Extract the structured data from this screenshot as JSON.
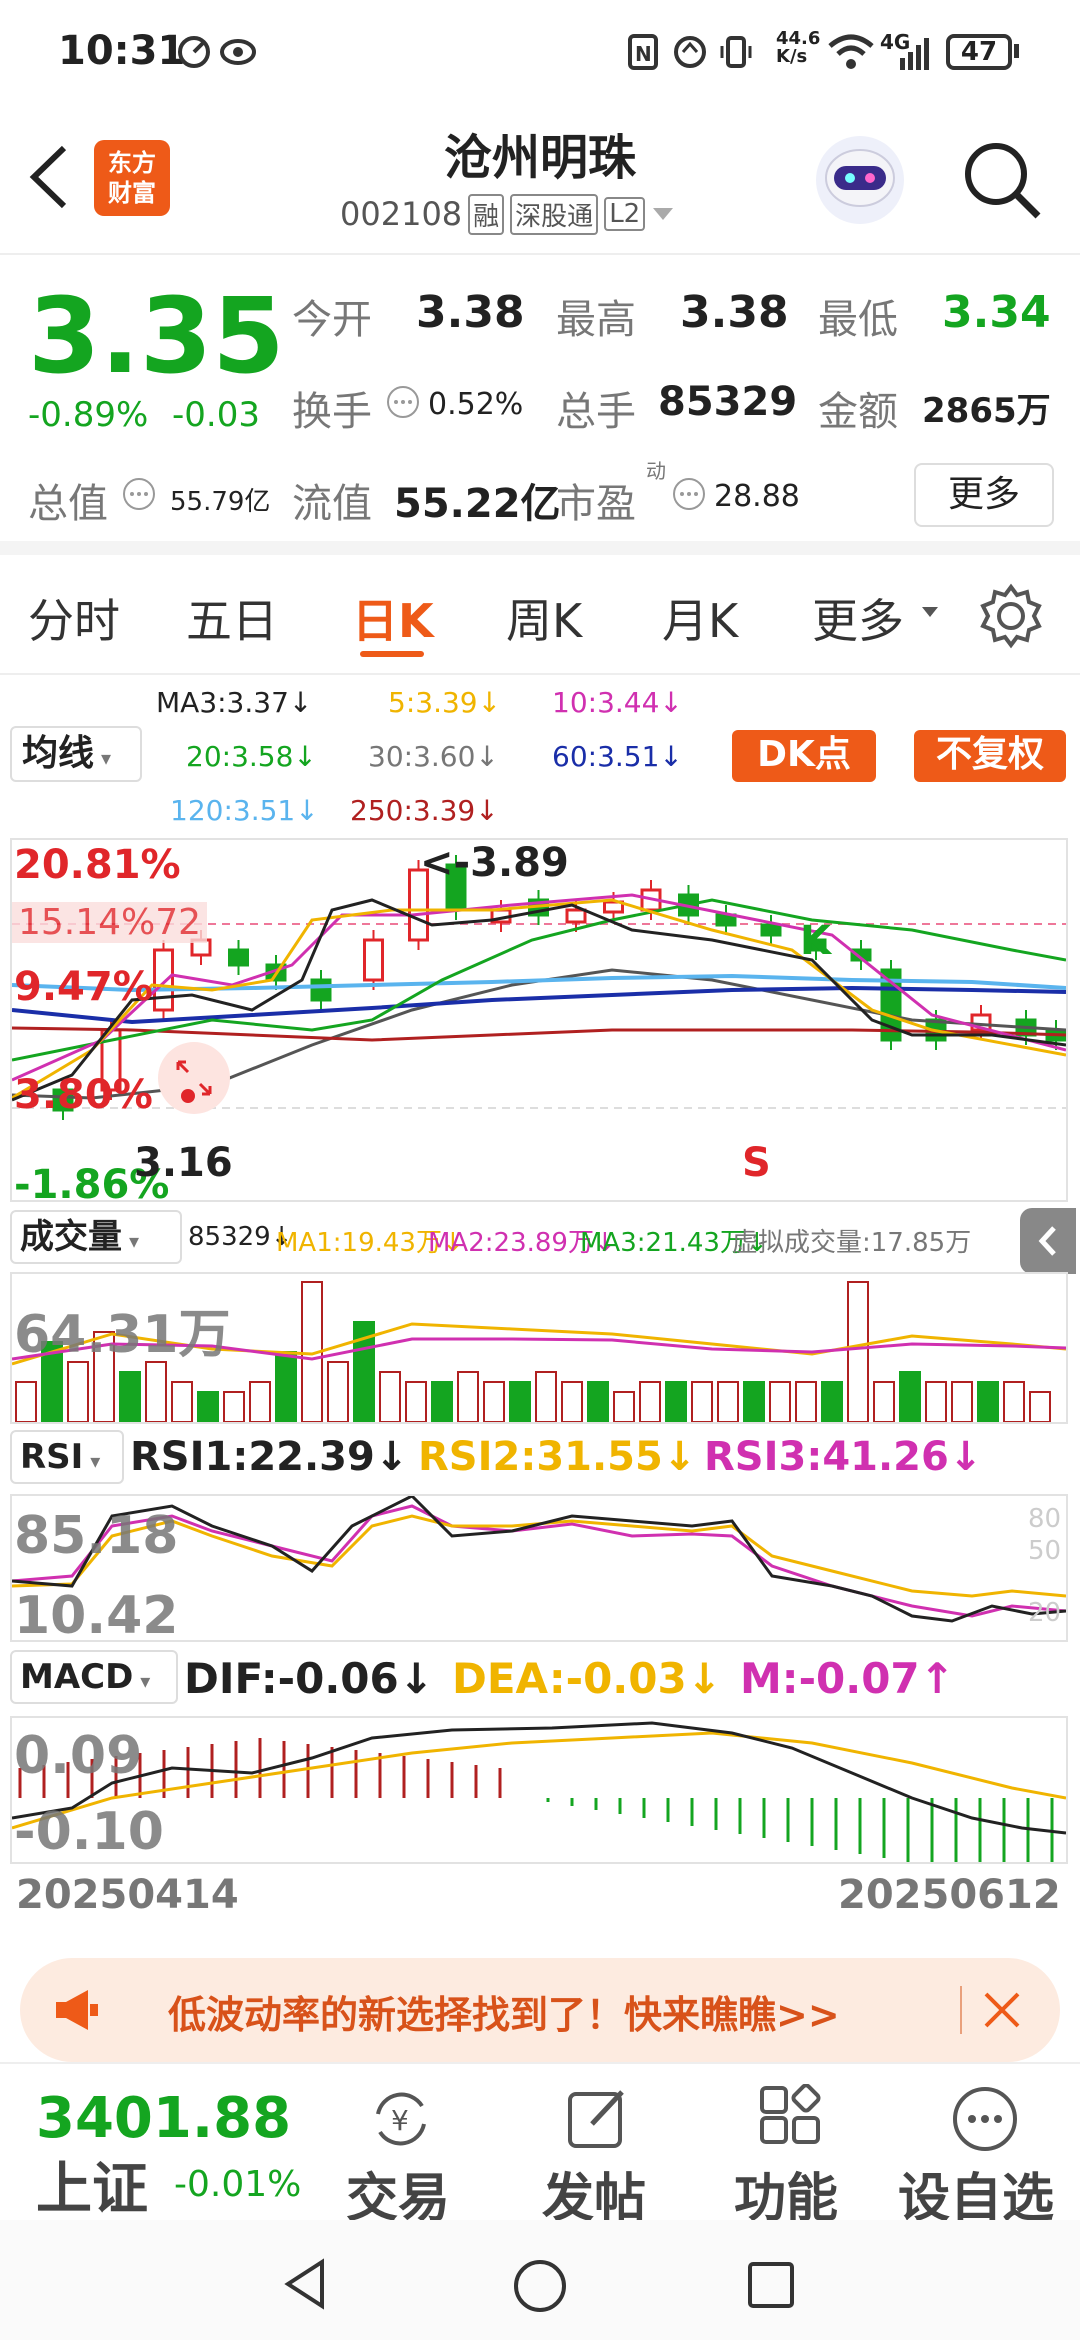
{
  "status": {
    "time": "10:31",
    "speed": "44.6\nK/s",
    "network": "4G",
    "battery": "47"
  },
  "header": {
    "title": "沧州明珠",
    "code": "002108",
    "tags": [
      "融",
      "深股通",
      "L2"
    ],
    "logo": "东方\n财富"
  },
  "quote": {
    "price": "3.35",
    "pct": "-0.89%",
    "chg": "-0.03",
    "open_l": "今开",
    "open": "3.38",
    "high_l": "最高",
    "high": "3.38",
    "low_l": "最低",
    "low": "3.34",
    "turn_l": "换手",
    "turn": "0.52%",
    "vol_l": "总手",
    "vol": "85329",
    "amt_l": "金额",
    "amt": "2865万",
    "mcap_l": "总值",
    "mcap": "55.79亿",
    "fcap_l": "流值",
    "fcap": "55.22亿",
    "pe_l": "市盈",
    "pe_sup": "动",
    "pe": "28.88",
    "more": "更多"
  },
  "tabs": [
    "分时",
    "五日",
    "日K",
    "周K",
    "月K",
    "更多"
  ],
  "ma": {
    "selector": "均线",
    "ma3": "MA3:3.37↓",
    "ma5": "5:3.39↓",
    "ma10": "10:3.44↓",
    "ma20": "20:3.58↓",
    "ma30": "30:3.60↓",
    "ma60": "60:3.51↓",
    "ma120": "120:3.51↓",
    "ma250": "250:3.39↓",
    "dk": "DK点",
    "fq": "不复权"
  },
  "kchart": {
    "p1": "20.81%",
    "p2": "15.14%",
    "p3": "9.47%",
    "p4": "3.80%",
    "p5": "-1.86%",
    "hi": "<-3.89",
    "lo": "3.16",
    "k": "K",
    "s": "S",
    "ghost": "15.14%72"
  },
  "volume": {
    "selector": "成交量",
    "v": "85329↓",
    "ma1": "MA1:19.43万↓",
    "ma2": "MA2:23.89万↓",
    "ma3": "MA3:21.43万↓",
    "virtual": "虚拟成交量:17.85万",
    "axis": "64.31万"
  },
  "rsi": {
    "selector": "RSI",
    "r1": "RSI1:22.39↓",
    "r2": "RSI2:31.55↓",
    "r3": "RSI3:41.26↓",
    "a1": "85.18",
    "a2": "10.42",
    "t80": "80",
    "t50": "50",
    "t20": "20"
  },
  "macd": {
    "selector": "MACD",
    "dif": "DIF:-0.06↓",
    "dea": "DEA:-0.03↓",
    "m": "M:-0.07↑",
    "a1": "0.09",
    "a2": "-0.10"
  },
  "dates": {
    "start": "20250414",
    "end": "20250612"
  },
  "banner": {
    "text": "低波动率的新选择找到了！快来瞧瞧>>"
  },
  "bottom": {
    "index_val": "3401.88",
    "index_name": "上证",
    "index_pct": "-0.01%",
    "trade": "交易",
    "post": "发帖",
    "func": "功能",
    "watch": "设自选"
  },
  "colors": {
    "up": "#e0262a",
    "down": "#14a520",
    "accent": "#ee5a18"
  }
}
